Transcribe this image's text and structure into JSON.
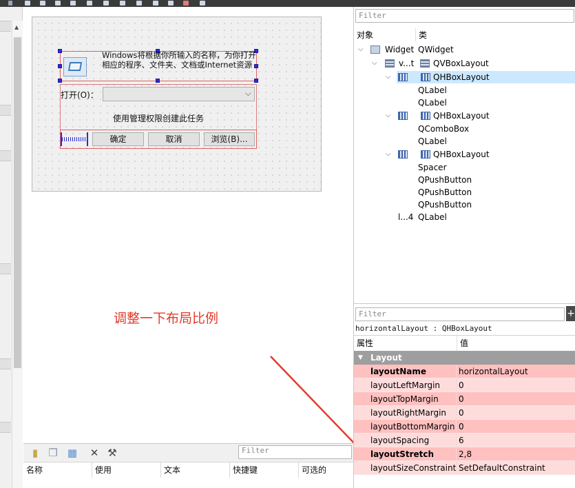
{
  "canvas": {
    "description_label": "Windows将根据你所输入的名称，为你打开相应的程序、文件夹、文档或Internet资源",
    "open_label": "打开(O)：",
    "admin_label": "使用管理权限创建此任务",
    "buttons": {
      "ok": "确定",
      "cancel": "取消",
      "browse": "浏览(B)..."
    }
  },
  "annotation": {
    "text": "调整一下布局比例",
    "color": "#e23a2a"
  },
  "action_editor": {
    "filter_placeholder": "Filter",
    "columns": [
      "名称",
      "使用",
      "文本",
      "快捷键",
      "可选的"
    ]
  },
  "object_inspector": {
    "filter_placeholder": "Filter",
    "header": {
      "object": "对象",
      "class": "类"
    },
    "rows": [
      {
        "name": "Widget",
        "cls": "QWidget"
      },
      {
        "name": "v...t",
        "cls": "QVBoxLayout"
      },
      {
        "name": "",
        "cls": "QHBoxLayout"
      },
      {
        "name": "",
        "cls": "QLabel"
      },
      {
        "name": "",
        "cls": "QLabel"
      },
      {
        "name": "",
        "cls": "QHBoxLayout"
      },
      {
        "name": "",
        "cls": "QComboBox"
      },
      {
        "name": "",
        "cls": "QLabel"
      },
      {
        "name": "",
        "cls": "QHBoxLayout"
      },
      {
        "name": "",
        "cls": "Spacer"
      },
      {
        "name": "",
        "cls": "QPushButton"
      },
      {
        "name": "",
        "cls": "QPushButton"
      },
      {
        "name": "",
        "cls": "QPushButton"
      },
      {
        "name": "l...4",
        "cls": "QLabel"
      }
    ]
  },
  "property_editor": {
    "filter_placeholder": "Filter",
    "title": "horizontalLayout : QHBoxLayout",
    "header": {
      "property": "属性",
      "value": "值"
    },
    "group": "Layout",
    "rows": [
      {
        "name": "layoutName",
        "value": "horizontalLayout"
      },
      {
        "name": "layoutLeftMargin",
        "value": "0"
      },
      {
        "name": "layoutTopMargin",
        "value": "0"
      },
      {
        "name": "layoutRightMargin",
        "value": "0"
      },
      {
        "name": "layoutBottomMargin",
        "value": "0"
      },
      {
        "name": "layoutSpacing",
        "value": "6"
      },
      {
        "name": "layoutStretch",
        "value": "2,8"
      },
      {
        "name": "layoutSizeConstraint",
        "value": "SetDefaultConstraint"
      }
    ]
  },
  "colors": {
    "selection": "#cce8ff",
    "property_row_a": "#ffc0c0",
    "property_row_b": "#ffdcdc",
    "group_header": "#9e9e9e"
  }
}
